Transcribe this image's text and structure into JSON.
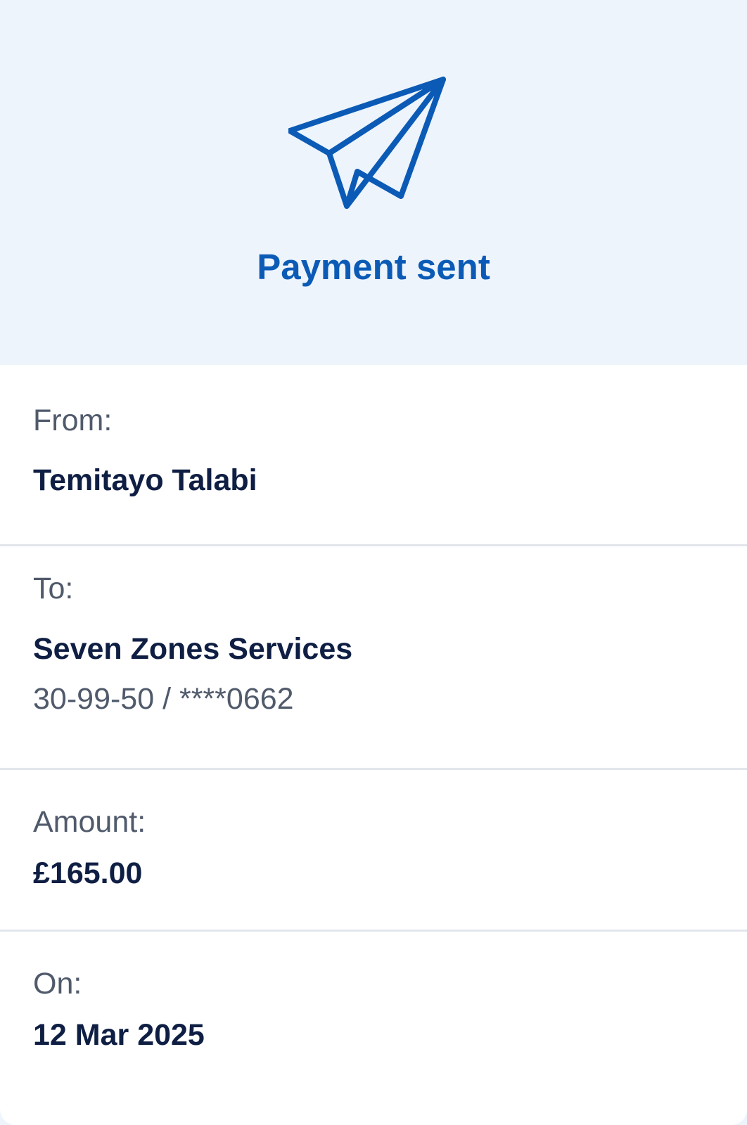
{
  "header": {
    "icon": "paper-plane-icon",
    "title": "Payment sent",
    "accent_color": "#0b5bb6",
    "background_color": "#edf4fc"
  },
  "details": {
    "from": {
      "label": "From:",
      "name": "Temitayo Talabi"
    },
    "to": {
      "label": "To:",
      "name": "Seven Zones Services",
      "account": "30-99-50 / ****0662"
    },
    "amount": {
      "label": "Amount:",
      "value": "£165.00"
    },
    "date": {
      "label": "On:",
      "value": "12 Mar 2025"
    }
  }
}
